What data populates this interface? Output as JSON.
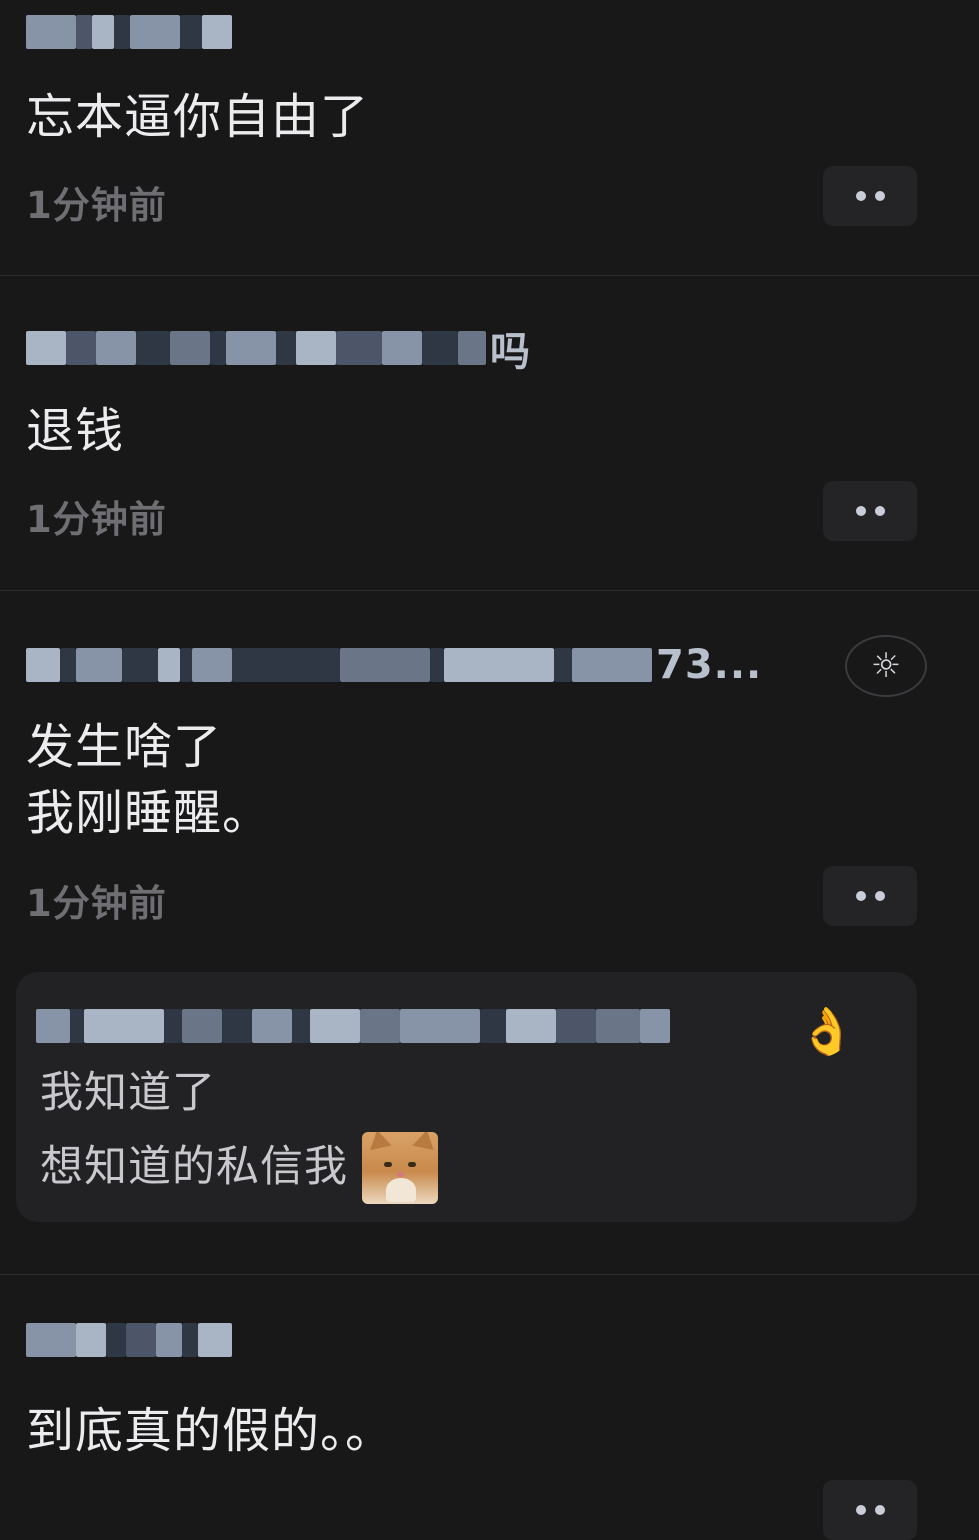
{
  "colors": {
    "background": "#181819",
    "text_primary": "#ececee",
    "text_secondary": "#6e6e73",
    "divider": "#2c2c2e",
    "reply_background": "#222224"
  },
  "comments": [
    {
      "username_obscured": true,
      "text": "忘本逼你自由了",
      "time": "1分钟前",
      "more_icon": "more-dots-icon"
    },
    {
      "username_obscured": true,
      "username_tail": "吗",
      "text": "退钱",
      "time": "1分钟前",
      "more_icon": "more-dots-icon"
    },
    {
      "username_obscured": true,
      "username_tail": "73...",
      "badge_icon": "sun-badge-icon",
      "text": "发生啥了\n我刚睡醒。",
      "time": "1分钟前",
      "more_icon": "more-dots-icon",
      "reply": {
        "username_obscured": true,
        "username_emoji": "👌",
        "lines": [
          "我知道了",
          "想知道的私信我"
        ],
        "sticker": "cat-sticker-icon"
      }
    },
    {
      "username_obscured": true,
      "text": "到底真的假的。。"
    }
  ]
}
